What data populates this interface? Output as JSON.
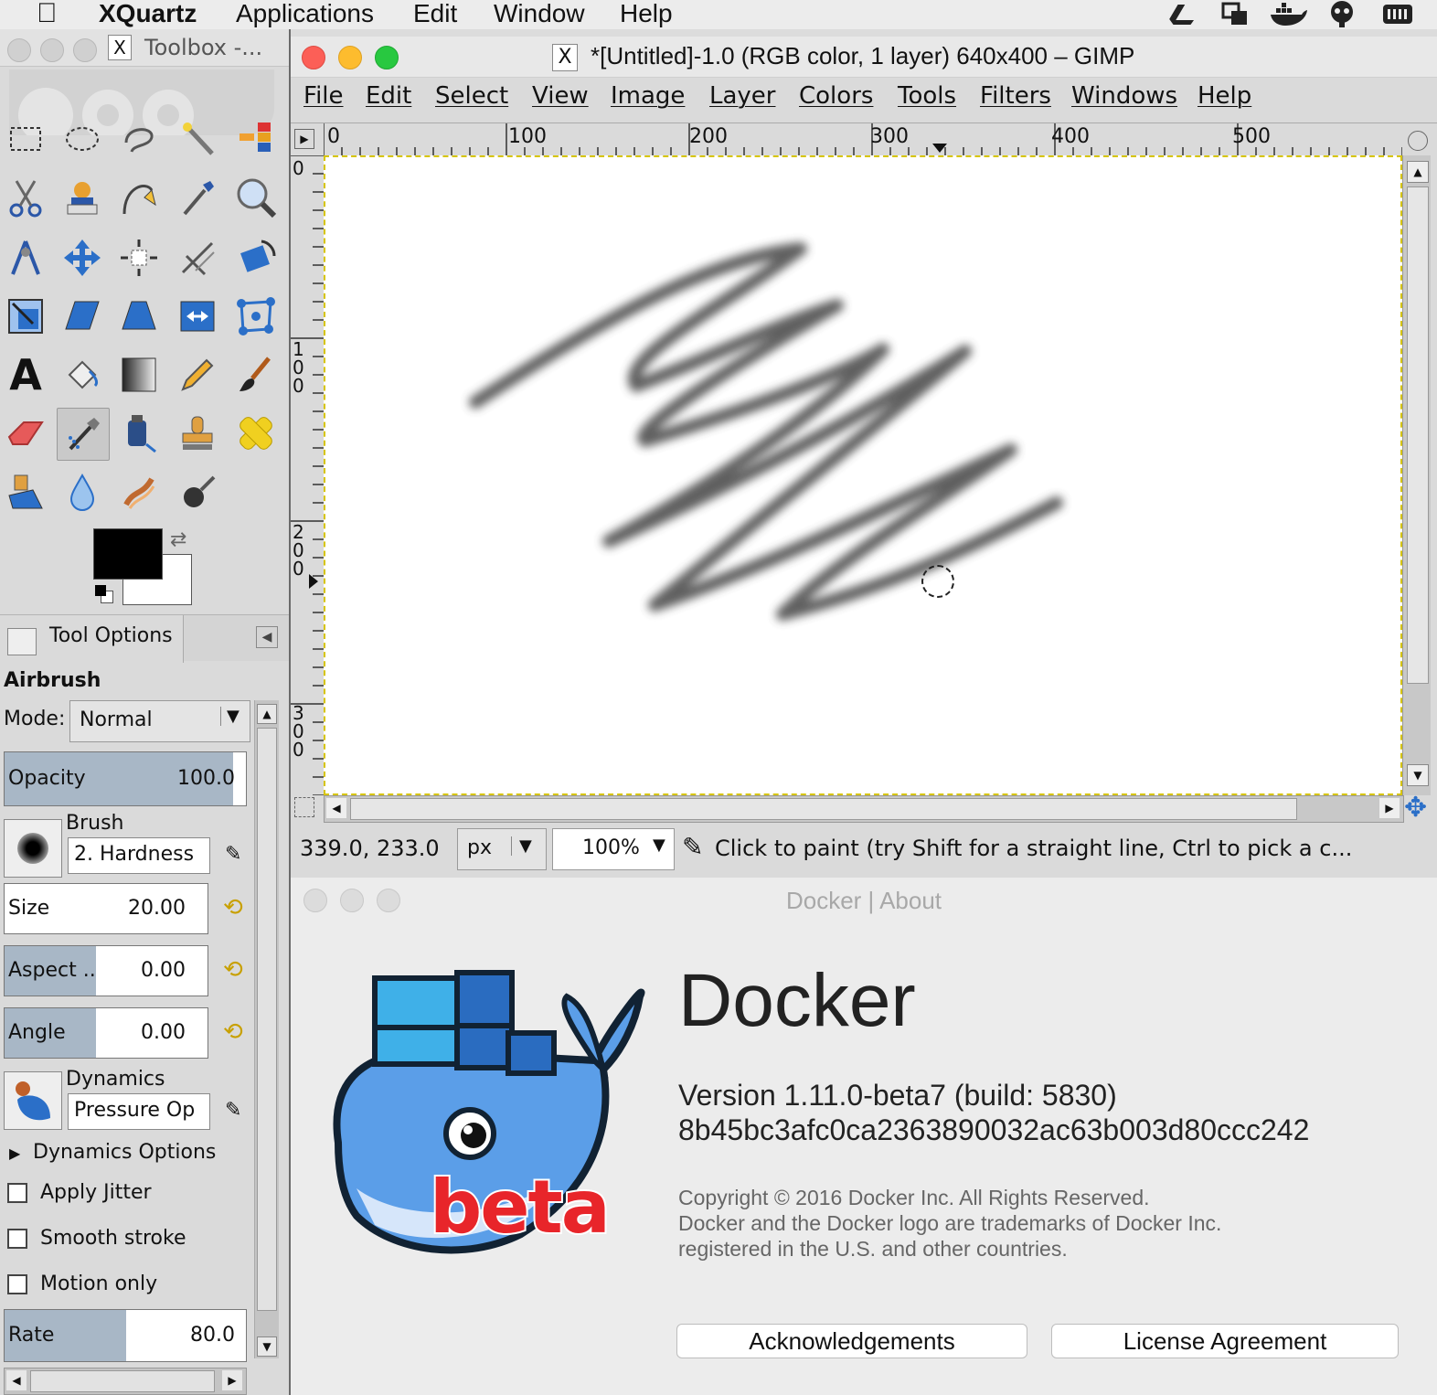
{
  "menubar": {
    "app": "XQuartz",
    "items": [
      "Applications",
      "Edit",
      "Window",
      "Help"
    ]
  },
  "toolbox": {
    "title": "Toolbox -...",
    "tool_options_tab": "Tool Options",
    "tool_name": "Airbrush",
    "mode_label": "Mode:",
    "mode_value": "Normal",
    "opacity_label": "Opacity",
    "opacity_value": "100.0",
    "brush_label": "Brush",
    "brush_value": "2. Hardness",
    "size_label": "Size",
    "size_value": "20.00",
    "aspect_label": "Aspect ..",
    "aspect_value": "0.00",
    "angle_label": "Angle",
    "angle_value": "0.00",
    "dynamics_label": "Dynamics",
    "dynamics_value": "Pressure Op",
    "dynamics_options": "Dynamics Options",
    "apply_jitter": "Apply Jitter",
    "smooth_stroke": "Smooth stroke",
    "motion_only": "Motion only",
    "rate_label": "Rate",
    "rate_value": "80.0",
    "fg_color": "#000000",
    "bg_color": "#ffffff"
  },
  "gimp": {
    "title": "*[Untitled]-1.0 (RGB color, 1 layer) 640x400 – GIMP",
    "menus": [
      "File",
      "Edit",
      "Select",
      "View",
      "Image",
      "Layer",
      "Colors",
      "Tools",
      "Filters",
      "Windows",
      "Help"
    ],
    "hruler": [
      "0",
      "100",
      "200",
      "300",
      "400",
      "500"
    ],
    "vruler": [
      "0",
      "1\n0\n0",
      "2\n0\n0",
      "3\n0\n0"
    ],
    "coords": "339.0, 233.0",
    "unit": "px",
    "zoom": "100%",
    "status_msg": "Click to paint (try Shift for a straight line, Ctrl to pick a c..."
  },
  "docker": {
    "window_title": "Docker | About",
    "app_name": "Docker",
    "version": "Version 1.11.0-beta7 (build: 5830)",
    "hash": "8b45bc3afc0ca2363890032ac63b003d80ccc242",
    "copyright_lines": [
      "Copyright © 2016 Docker Inc. All Rights Reserved.",
      "Docker and the Docker logo are trademarks of Docker Inc.",
      "registered in the U.S. and other countries."
    ],
    "badge": "beta",
    "ack_button": "Acknowledgements",
    "license_button": "License Agreement"
  }
}
